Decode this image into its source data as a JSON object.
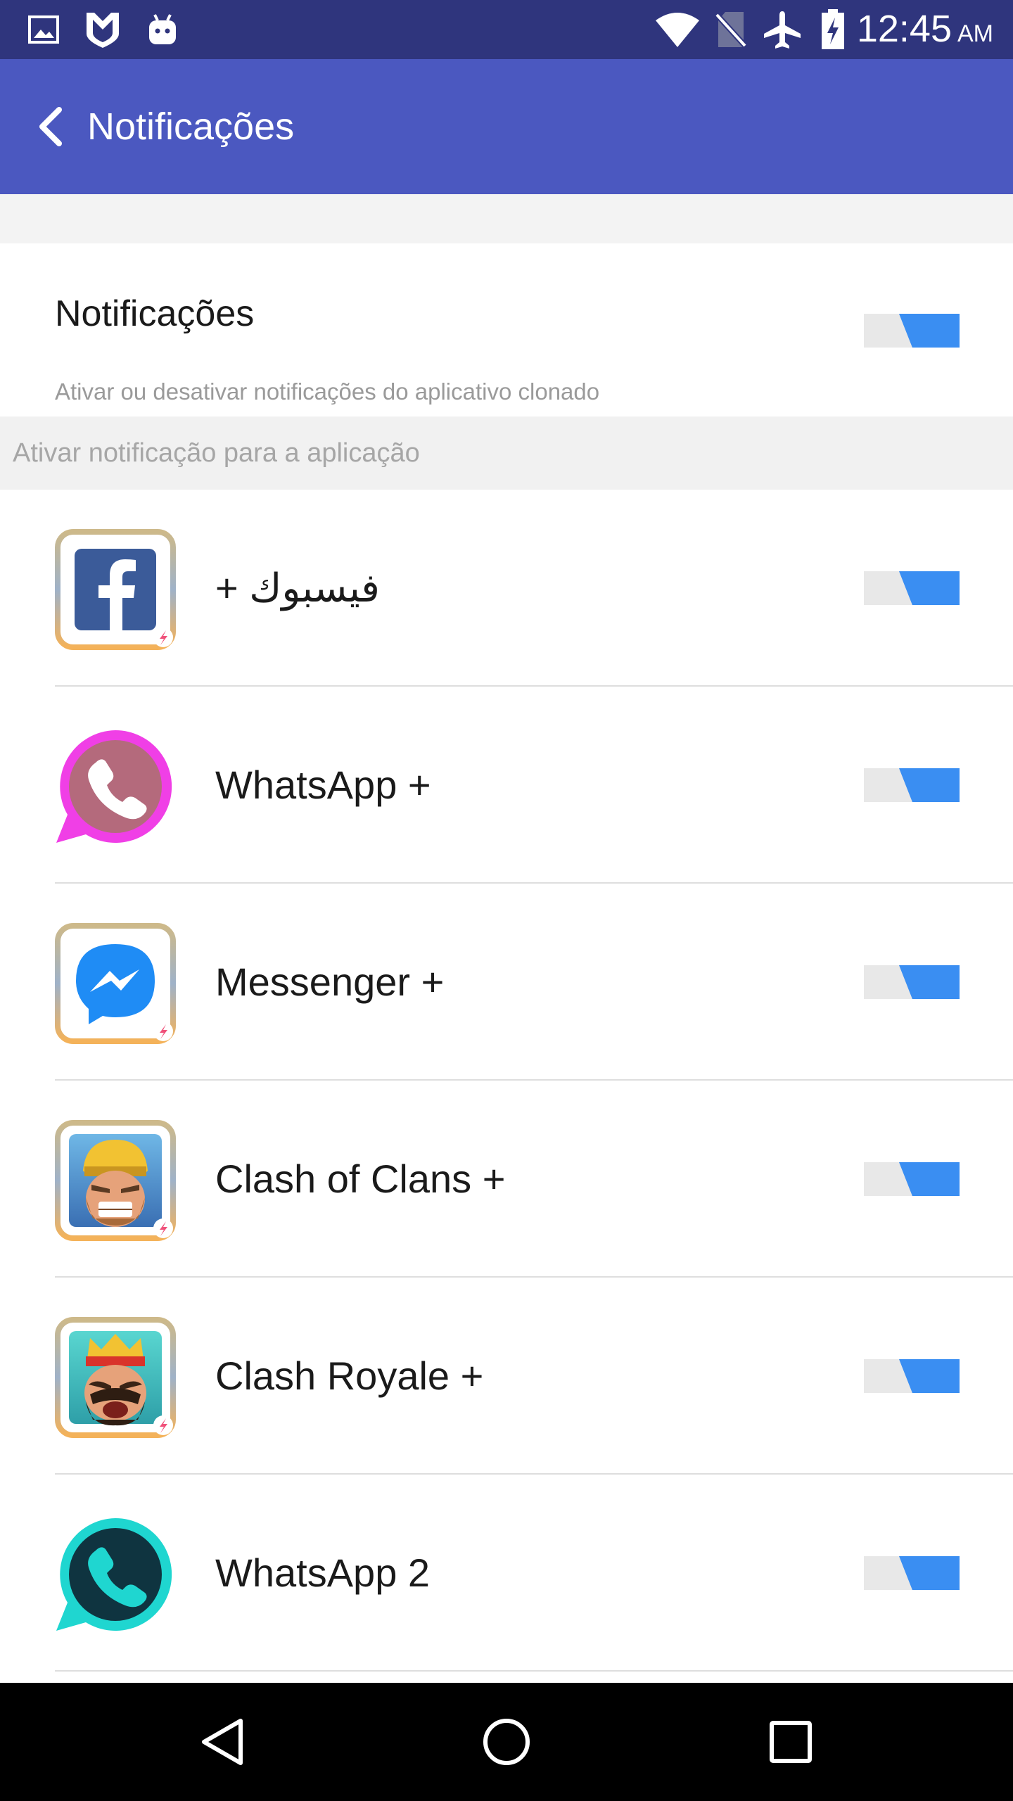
{
  "status_bar": {
    "time": "12:45",
    "ampm": "AM",
    "icons": [
      "image-icon",
      "shield-icon",
      "android-icon",
      "wifi-icon",
      "no-sim-icon",
      "airplane-mode-icon",
      "battery-charging-icon"
    ]
  },
  "app_bar": {
    "title": "Notificações",
    "back_icon": "chevron-left-icon",
    "color": "#4b58c0"
  },
  "master": {
    "title": "Notificações",
    "subtitle": "Ativar ou desativar notificações do aplicativo clonado",
    "enabled": true
  },
  "section_header": "Ativar notificação para a aplicação",
  "apps": [
    {
      "label": "فيسبوك +",
      "icon": "facebook-icon",
      "enabled": true
    },
    {
      "label": "WhatsApp +",
      "icon": "whatsapp-pink-icon",
      "enabled": true
    },
    {
      "label": "Messenger +",
      "icon": "messenger-icon",
      "enabled": true
    },
    {
      "label": "Clash of Clans +",
      "icon": "clash-of-clans-icon",
      "enabled": true
    },
    {
      "label": "Clash Royale +",
      "icon": "clash-royale-icon",
      "enabled": true
    },
    {
      "label": "WhatsApp 2",
      "icon": "whatsapp-cyan-icon",
      "enabled": true
    }
  ],
  "toggle_color": "#3a8ef2",
  "nav_bar": {
    "icons": [
      "back-triangle-icon",
      "home-circle-icon",
      "recents-square-icon"
    ]
  }
}
